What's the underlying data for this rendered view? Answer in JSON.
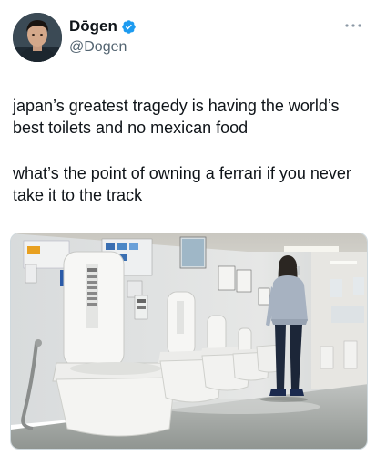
{
  "author": {
    "display_name": "Dōgen",
    "handle": "@Dogen",
    "verified": true,
    "avatar_icon": "person-avatar",
    "verified_icon": "verified-badge-icon",
    "more_icon": "more-options-icon"
  },
  "tweet": {
    "paragraphs": [
      "japan’s greatest tragedy is having the world’s best toilets and no mexican food",
      "what’s the point of owning a ferrari if you never take it to the track"
    ]
  },
  "media": {
    "type": "photo",
    "subject": "toilet-showroom-photo"
  },
  "colors": {
    "text": "#0f1419",
    "secondary": "#536471",
    "verified_blue": "#1d9bf0",
    "border": "#cfd9de"
  }
}
